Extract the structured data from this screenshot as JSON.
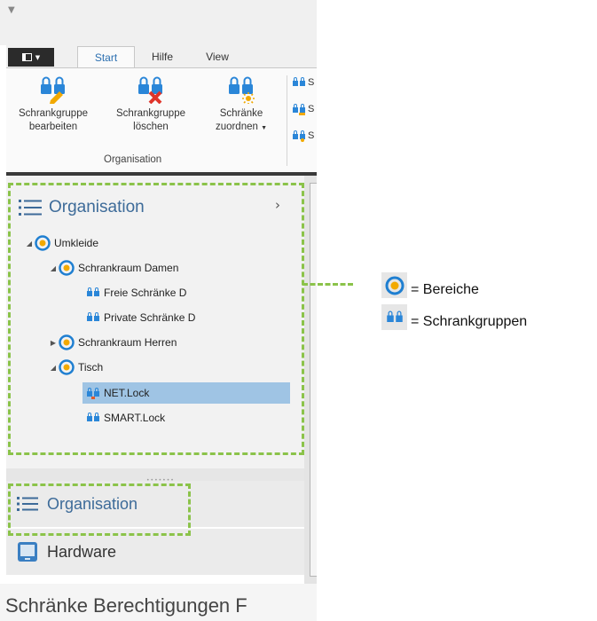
{
  "quick_access": {
    "icon": "dropdown-arrow"
  },
  "menu": {
    "file_icon": "app-menu-icon",
    "tabs": [
      {
        "label": "Start",
        "active": true
      },
      {
        "label": "Hilfe",
        "active": false
      },
      {
        "label": "View",
        "active": false
      }
    ]
  },
  "ribbon": {
    "buttons": [
      {
        "line1": "Schrankgruppe",
        "line2": "bearbeiten",
        "icon": "edit-lockergroup-icon"
      },
      {
        "line1": "Schrankgruppe",
        "line2": "löschen",
        "icon": "delete-lockergroup-icon"
      },
      {
        "line1": "Schränke",
        "line2": "zuordnen",
        "icon": "assign-lockers-icon"
      }
    ],
    "group_label": "Organisation",
    "small_items": [
      {
        "label": "S"
      },
      {
        "label": "S"
      },
      {
        "label": "S"
      }
    ]
  },
  "panel": {
    "title": "Organisation",
    "expand_icon": "chevron-right-icon",
    "tree": [
      {
        "label": "Umkleide",
        "level": 0,
        "type": "bereich",
        "expanded": true
      },
      {
        "label": "Schrankraum Damen",
        "level": 1,
        "type": "bereich",
        "expanded": true
      },
      {
        "label": "Freie Schränke D",
        "level": 2,
        "type": "schrankgruppe"
      },
      {
        "label": "Private Schränke D",
        "level": 2,
        "type": "schrankgruppe"
      },
      {
        "label": "Schrankraum Herren",
        "level": 1,
        "type": "bereich",
        "expanded": false
      },
      {
        "label": "Tisch",
        "level": 1,
        "type": "bereich",
        "expanded": true
      },
      {
        "label": "NET.Lock",
        "level": 2,
        "type": "schrankgruppe",
        "selected": true
      },
      {
        "label": "SMART.Lock",
        "level": 2,
        "type": "schrankgruppe"
      }
    ]
  },
  "nav": {
    "items": [
      {
        "label": "Organisation",
        "icon": "list-icon",
        "active": true
      },
      {
        "label": "Hardware",
        "icon": "tablet-icon",
        "active": false
      }
    ]
  },
  "bottom": {
    "text": "Schränke Berechtigungen F"
  },
  "legend": {
    "items": [
      {
        "icon": "bereich-icon",
        "label": "= Bereiche"
      },
      {
        "icon": "schrankgruppe-icon",
        "label": "= Schrankgruppen"
      }
    ]
  },
  "colors": {
    "accent": "#3d6b99",
    "selection": "#9fc4e4",
    "highlight_dash": "#8bc34a",
    "bereich_icon": "#1f7fd1",
    "bereich_accent": "#f2a900",
    "lockgroup_icon": "#2a86d8"
  }
}
